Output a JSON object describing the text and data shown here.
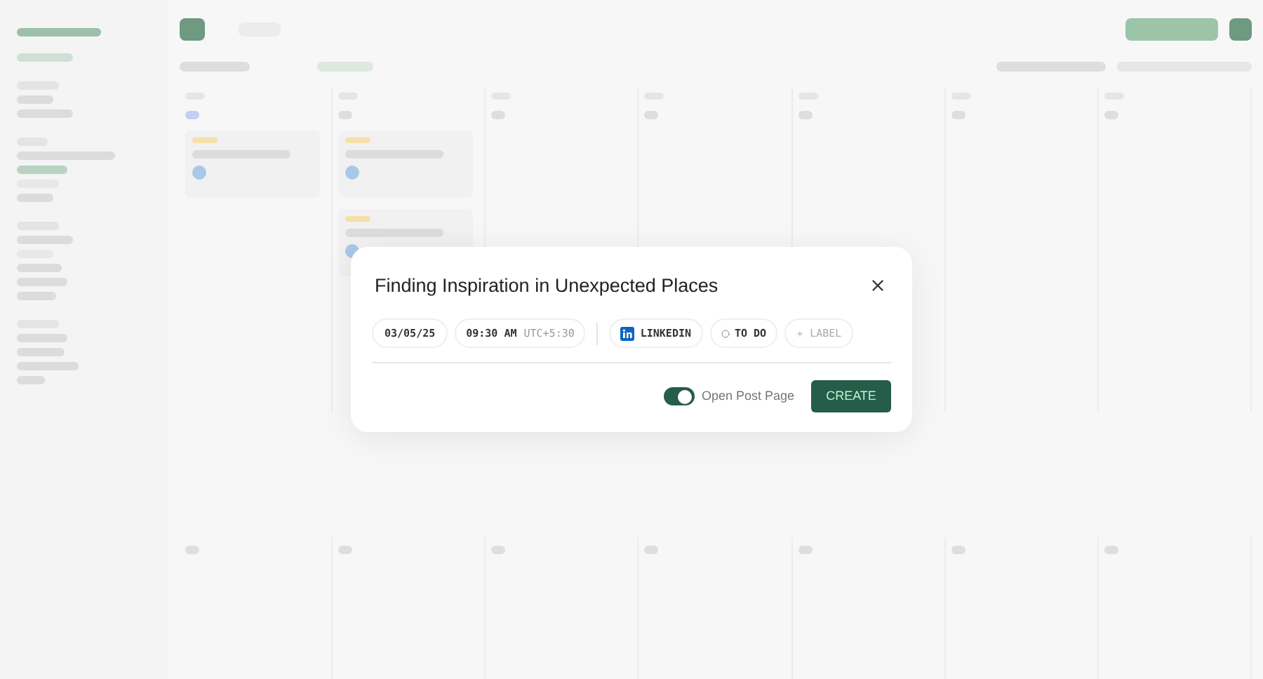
{
  "dialog": {
    "title": "Finding Inspiration in Unexpected Places",
    "date": "03/05/25",
    "time": "09:30 AM",
    "timezone": "UTC+5:30",
    "platform": "LINKEDIN",
    "status": "TO DO",
    "label_placeholder": "LABEL",
    "open_post_page": {
      "label": "Open Post Page",
      "on": true
    },
    "create": "CREATE"
  }
}
